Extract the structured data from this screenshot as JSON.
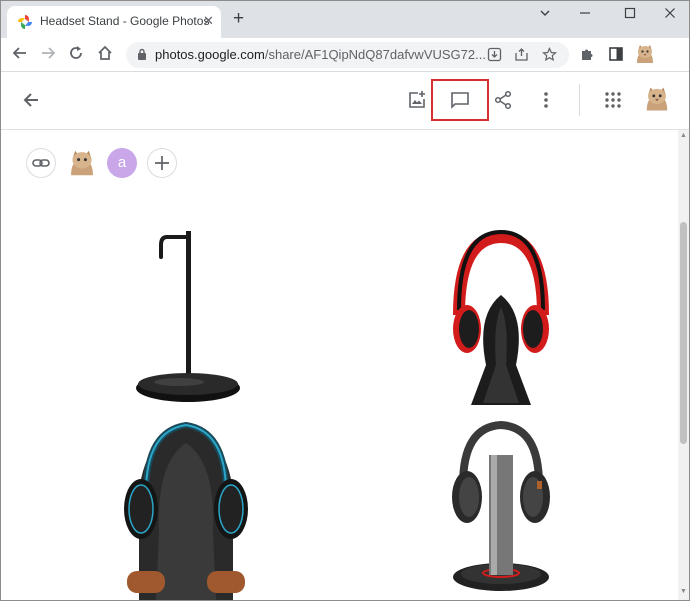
{
  "browser": {
    "tab_title": "Headset Stand - Google Photos",
    "url_host": "photos.google.com",
    "url_path": "/share/AF1QipNdQ87dafvwVUSG72...",
    "new_tab_symbol": "+",
    "window_controls": [
      "minimize-icon",
      "maximize-icon",
      "close-icon"
    ]
  },
  "photos_header": {
    "icons": [
      "back-arrow-icon",
      "add-to-album-icon",
      "comment-icon",
      "share-icon",
      "more-options-icon",
      "apps-grid-icon",
      "account-avatar"
    ],
    "highlighted": "comment-icon",
    "highlight_color": "#d32f2f"
  },
  "album": {
    "share_chips": [
      "link-icon",
      "cat-avatar",
      "user-avatar-a",
      "add-person-icon"
    ],
    "user_initial": "a",
    "avatar_color": "#c9a7e8"
  },
  "photos": [
    {
      "subject": "black metal headphone hanger stand"
    },
    {
      "subject": "red headphones on black acrylic stand"
    },
    {
      "subject": "headphones on black stand with wooden feet"
    },
    {
      "subject": "headphones on metal stand with round base"
    }
  ]
}
